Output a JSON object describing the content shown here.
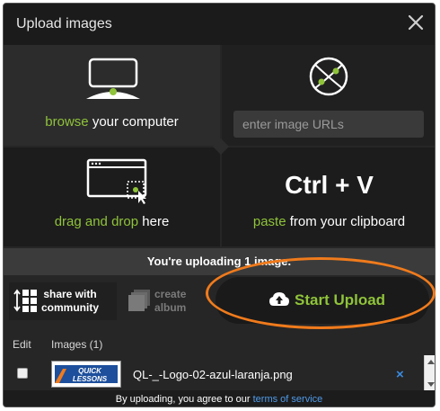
{
  "dialog": {
    "title": "Upload images",
    "close_icon": "close-icon"
  },
  "browse": {
    "accent": "browse",
    "rest": "your computer",
    "icon": "monitor-icon"
  },
  "url": {
    "placeholder": "enter image URLs",
    "icon": "globe-link-icon"
  },
  "drag": {
    "accent": "drag and drop",
    "rest": "here",
    "icon": "drag-window-icon"
  },
  "paste": {
    "shortcut": "Ctrl + V",
    "accent": "paste",
    "rest": "from your clipboard"
  },
  "status": "You're uploading 1 image.",
  "actions": {
    "share_line1": "share with",
    "share_line2": "community",
    "album_line1": "create",
    "album_line2": "album",
    "upload_label": "Start Upload"
  },
  "table": {
    "col_edit": "Edit",
    "col_images": "Images (1)",
    "files": [
      {
        "name": "QL-_-Logo-02-azul-laranja.png",
        "thumb_text": "QUICK LESSONS",
        "remove": "×"
      }
    ]
  },
  "footer": {
    "text": "By uploading, you agree to our",
    "link": "terms of service"
  },
  "colors": {
    "accent": "#8fc33a",
    "highlight": "#f07b1c",
    "link": "#4f9bea"
  }
}
